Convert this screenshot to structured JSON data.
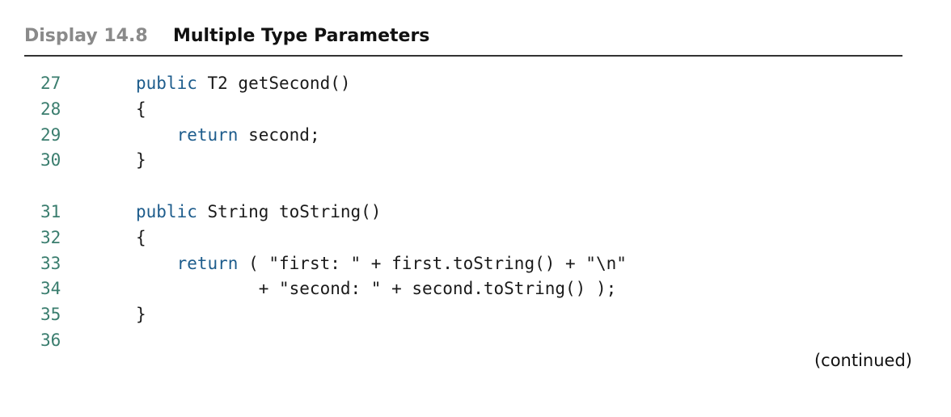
{
  "header": {
    "display_label": "Display 14.8",
    "title": "Multiple Type Parameters"
  },
  "code_lines": [
    {
      "num": "27",
      "kw": "public",
      "rest": " T2 getSecond()",
      "indent": ""
    },
    {
      "num": "28",
      "kw": "",
      "rest": "{",
      "indent": ""
    },
    {
      "num": "29",
      "kw": "return",
      "rest": " second;",
      "indent": "    "
    },
    {
      "num": "30",
      "kw": "",
      "rest": "}",
      "indent": ""
    },
    {
      "num": "31",
      "kw": "public",
      "rest": " String toString()",
      "indent": ""
    },
    {
      "num": "32",
      "kw": "",
      "rest": "{",
      "indent": ""
    },
    {
      "num": "33",
      "kw": "return",
      "rest": " ( \"first: \" + first.toString() + \"\\n\"",
      "indent": "    "
    },
    {
      "num": "34",
      "kw": "",
      "rest": "+ \"second: \" + second.toString() );",
      "indent": "            "
    },
    {
      "num": "35",
      "kw": "",
      "rest": "}",
      "indent": ""
    },
    {
      "num": "36",
      "kw": "",
      "rest": "",
      "indent": ""
    }
  ],
  "footer": {
    "continued": "(continued)"
  },
  "colors": {
    "keyword": "#1d5c8c",
    "line_number": "#3a7d6e",
    "display_label": "#8a8a8a"
  }
}
